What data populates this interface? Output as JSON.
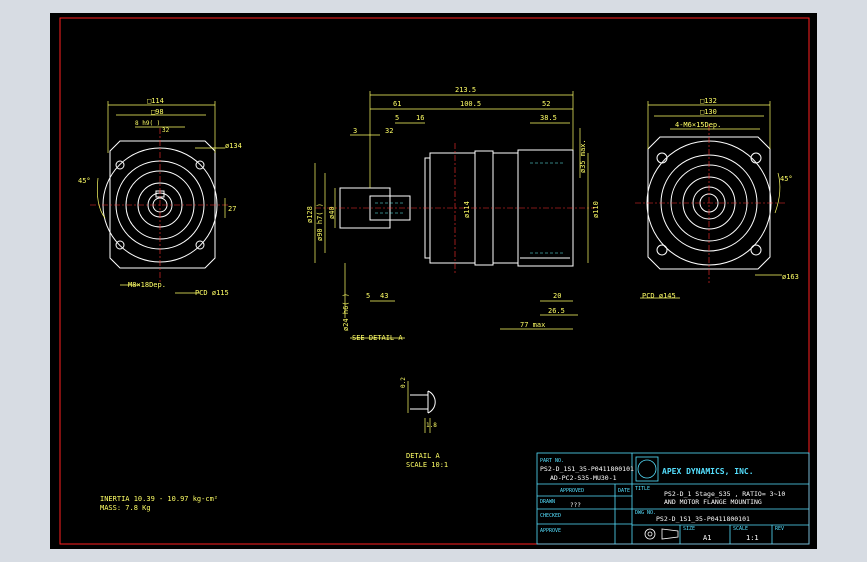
{
  "frame": {
    "border_color": "#ff2020",
    "line_color": "#ffffff",
    "dim_color": "#ffff66",
    "center_color": "#ff3030",
    "hidden_color": "#66ffff"
  },
  "front_view": {
    "square": "□114",
    "square2": "□98",
    "key": "8 h9(  )",
    "mid": "32",
    "dia": "ø134",
    "angle": "45°",
    "depth": "27",
    "bolt": "M8×18Dep.",
    "pcd": "PCD ø115"
  },
  "side_view": {
    "overall": "213.5",
    "left": "61",
    "middle": "100.5",
    "right": "52",
    "d5": "5",
    "d16": "16",
    "d3": "3",
    "d32": "32",
    "d385": "38.5",
    "shaft1": "ø128",
    "shaft2": "ø90 h7(  )",
    "shaft3": "ø40",
    "body": "ø114",
    "flange": "ø110",
    "flange_note": "ø35 max.",
    "key": "ø24 h6(  )",
    "l5": "5",
    "l43": "43",
    "d20": "20",
    "d265": "26.5",
    "max": "77 max",
    "see": "SEE DETAIL A"
  },
  "back_view": {
    "square": "□132",
    "square2": "□130",
    "holes": "4-M6×15Dep.",
    "angle": "45°",
    "pcd": "PCD ø145",
    "dia": "ø163"
  },
  "detail": {
    "dim": "0.2",
    "dim2": "1.8",
    "label": "DETAIL A",
    "scale": "SCALE 10:1"
  },
  "notes": {
    "inertia": "INERTIA 10.39 - 10.97 kg-cm²",
    "mass": "MASS: 7.8  Kg"
  },
  "title_block": {
    "part_no_label": "PART NO.",
    "part_no_1": "PS2-D_1S1_35-P0411800101",
    "part_no_2": "AD-PC2-S35-MU30-1",
    "company": "APEX DYNAMICS, INC.",
    "approved_label": "APPROVED",
    "date_label": "DATE",
    "drawn_label": "DRAWN",
    "drawn_value": "???",
    "checked_label": "CHECKED",
    "approve_label": "APPROVE",
    "title_label": "TITLE",
    "title_1": "PS2-D_1 Stage_S35 , RATIO= 3~10",
    "title_2": "AND MOTOR FLANGE MOUNTING",
    "dwg_label": "DWG NO.",
    "dwg_no": "PS2-D_1S1_35-P0411800101",
    "size_label": "SIZE",
    "size": "A1",
    "scale_label": "SCALE",
    "scale": "1:1",
    "rev_label": "REV"
  }
}
